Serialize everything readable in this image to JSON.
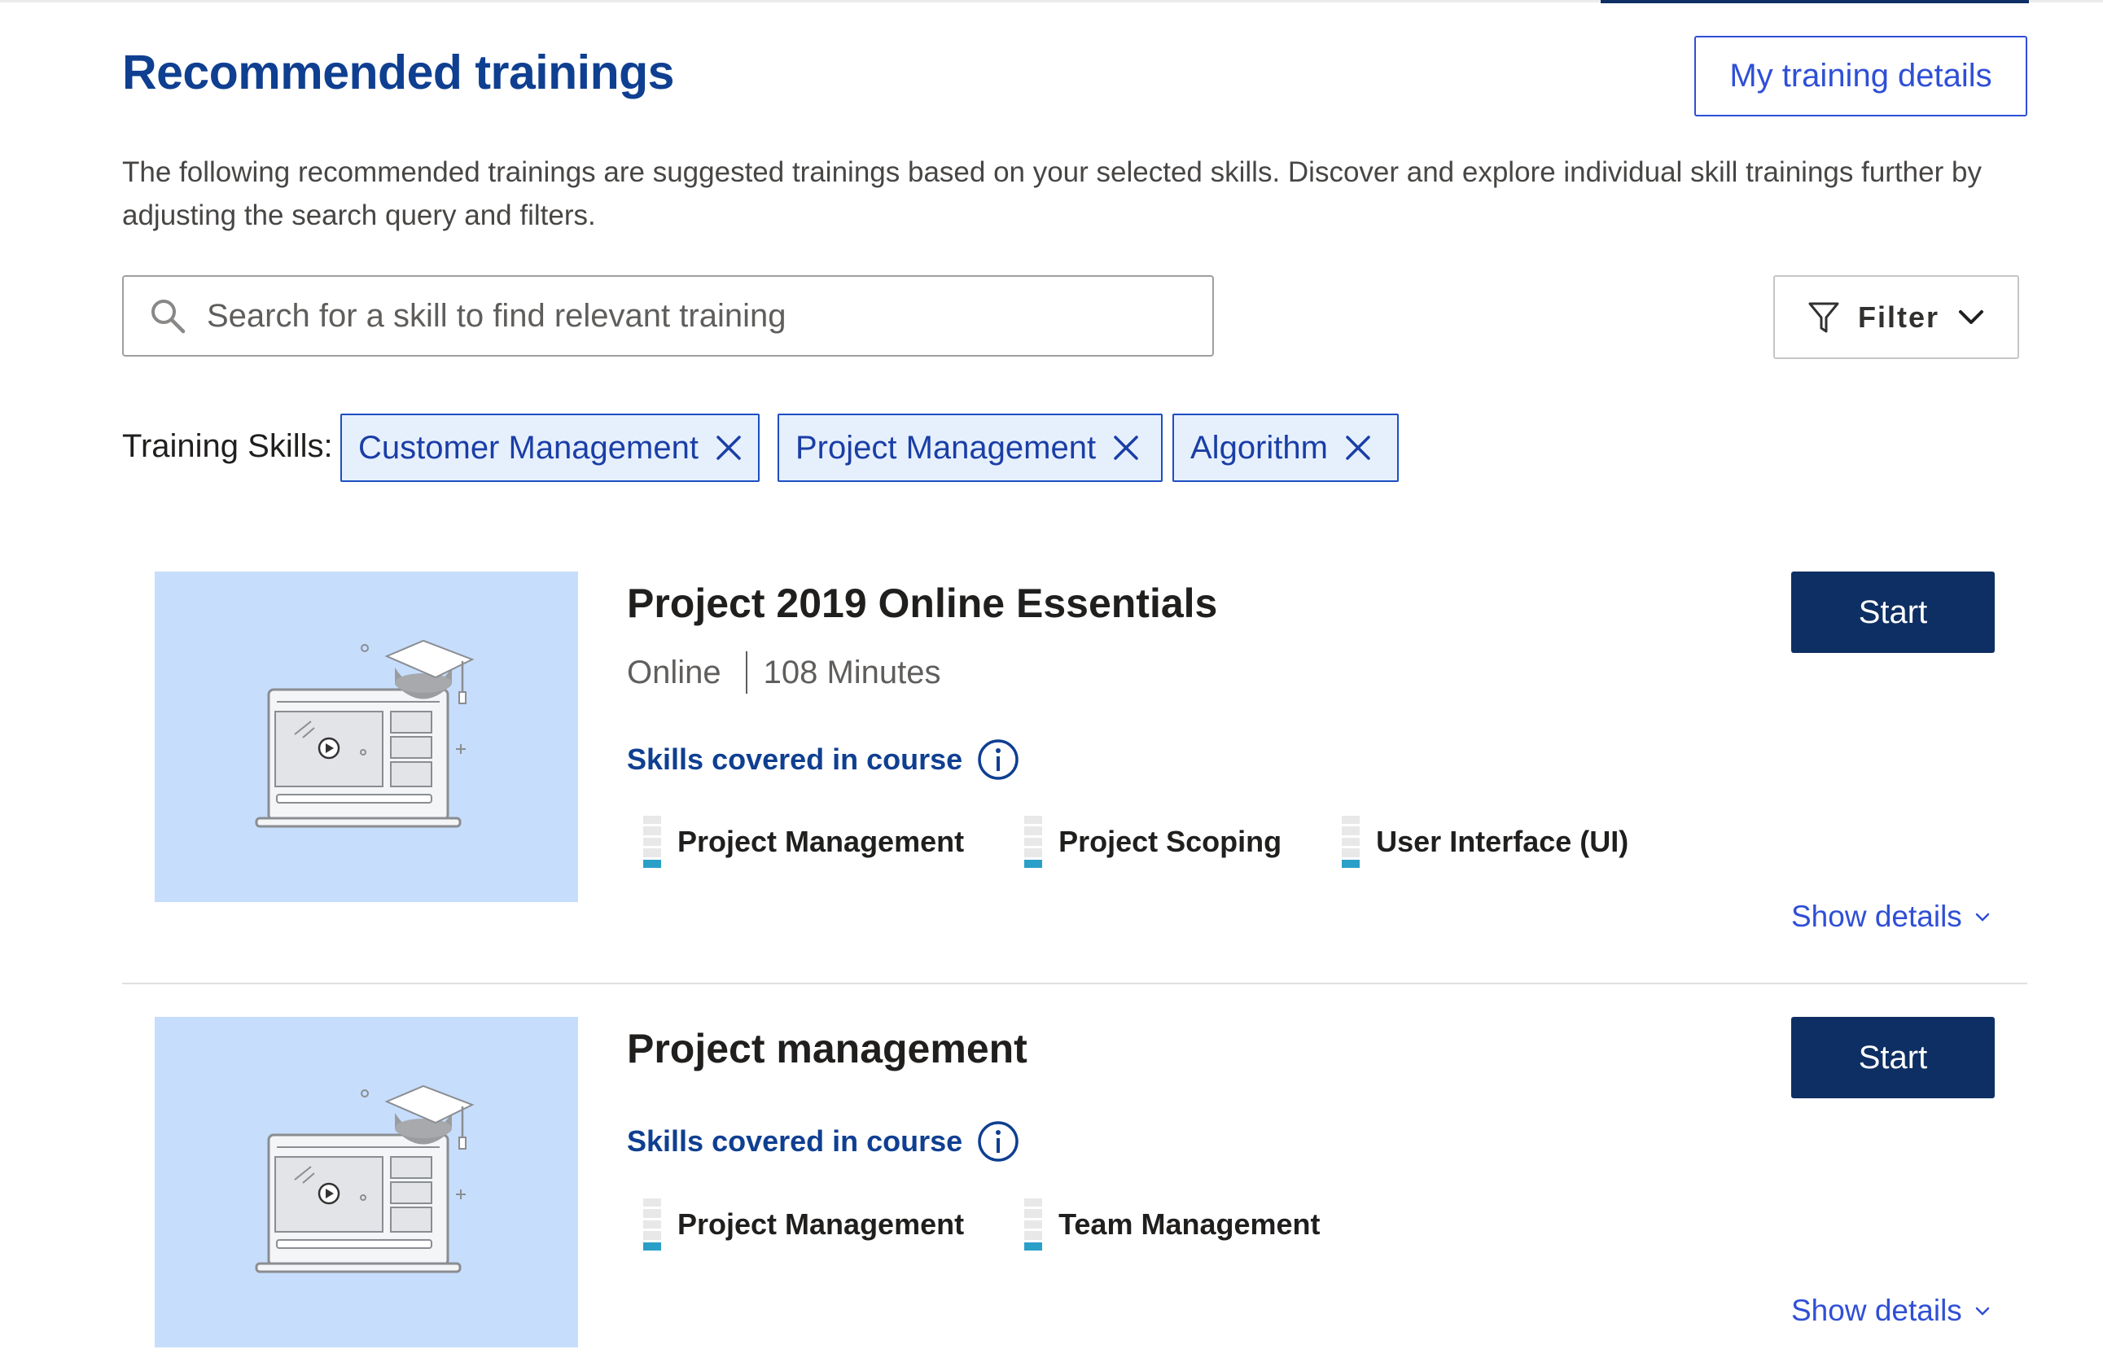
{
  "header": {
    "title": "Recommended trainings",
    "my_details_label": "My training details"
  },
  "description": "The following recommended trainings are suggested trainings based on your selected skills. Discover and explore individual skill trainings further by adjusting the search query and filters.",
  "search": {
    "placeholder": "Search for a skill to find relevant training",
    "value": "",
    "icon": "search-icon"
  },
  "filter": {
    "label": "Filter",
    "icon": "filter-icon",
    "chevron": "chevron-down-icon"
  },
  "training_skills": {
    "label": "Training Skills:",
    "chips": [
      {
        "label": "Customer Management"
      },
      {
        "label": "Project Management"
      },
      {
        "label": "Algorithm"
      }
    ]
  },
  "courses": [
    {
      "title": "Project 2019 Online Essentials",
      "format": "Online",
      "duration": "108 Minutes",
      "skills_heading": "Skills covered in course",
      "skills": [
        {
          "name": "Project Management",
          "level": 0.2
        },
        {
          "name": "Project Scoping",
          "level": 0.2
        },
        {
          "name": "User Interface (UI)",
          "level": 0.2
        }
      ],
      "start_label": "Start",
      "show_details_label": "Show details"
    },
    {
      "title": "Project management",
      "skills_heading": "Skills covered in course",
      "skills": [
        {
          "name": "Project Management",
          "level": 0.2
        },
        {
          "name": "Team Management",
          "level": 0.2
        }
      ],
      "start_label": "Start",
      "show_details_label": "Show details"
    }
  ],
  "colors": {
    "accent": "#0f3f91",
    "link": "#2f4fd6",
    "primary_button": "#0e2f63",
    "chip_bg": "#e6f0fd",
    "thumbnail_bg": "#c7ddfc",
    "skill_fill": "#2aa0c8"
  }
}
